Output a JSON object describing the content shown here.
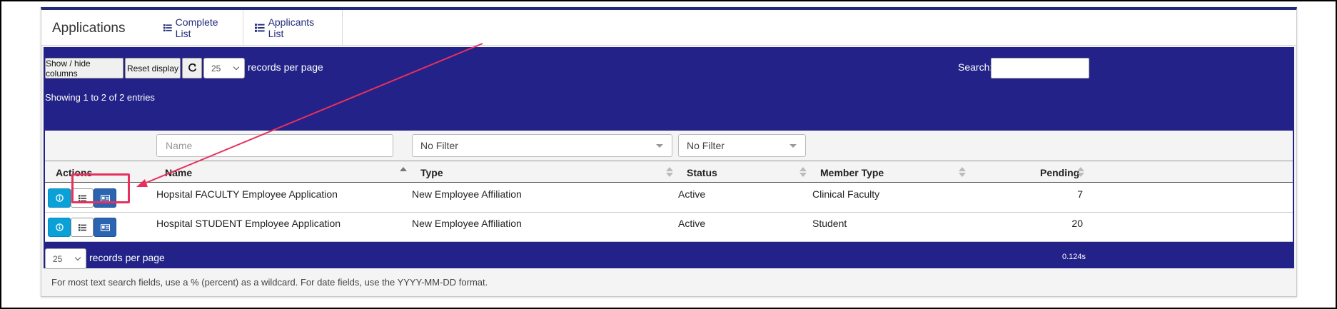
{
  "panel": {
    "title": "Applications",
    "tabs": [
      {
        "label": "Complete List"
      },
      {
        "label": "Applicants List"
      }
    ]
  },
  "toolbar": {
    "show_hide_label": "Show / hide columns",
    "reset_label": "Reset display",
    "page_size": "25",
    "records_per_page": "records per page",
    "search_label": "Search:",
    "search_value": ""
  },
  "info": {
    "showing": "Showing 1 to 2 of 2 entries"
  },
  "filters": {
    "name_placeholder": "Name",
    "type_value": "No Filter",
    "status_value": "No Filter"
  },
  "columns": {
    "actions": "Actions",
    "name": "Name",
    "type": "Type",
    "status": "Status",
    "member_type": "Member Type",
    "pending": "Pending"
  },
  "rows": [
    {
      "name": "Hopsital FACULTY Employee Application",
      "type": "New Employee Affiliation",
      "status": "Active",
      "member_type": "Clinical Faculty",
      "pending": "7"
    },
    {
      "name": "Hospital STUDENT Employee Application",
      "type": "New Employee Affiliation",
      "status": "Active",
      "member_type": "Student",
      "pending": "20"
    }
  ],
  "footer": {
    "page_size": "25",
    "records_per_page": "records per page",
    "timing": "0.124s"
  },
  "note": "For most text search fields, use a % (percent) as a wildcard. For date fields, use the YYYY-MM-DD format.",
  "colors": {
    "bar_blue": "#222288",
    "header_accent": "#222c7a",
    "info_button": "#0aa0d8",
    "card_button": "#2b64b0",
    "annotation": "#e8305e"
  }
}
